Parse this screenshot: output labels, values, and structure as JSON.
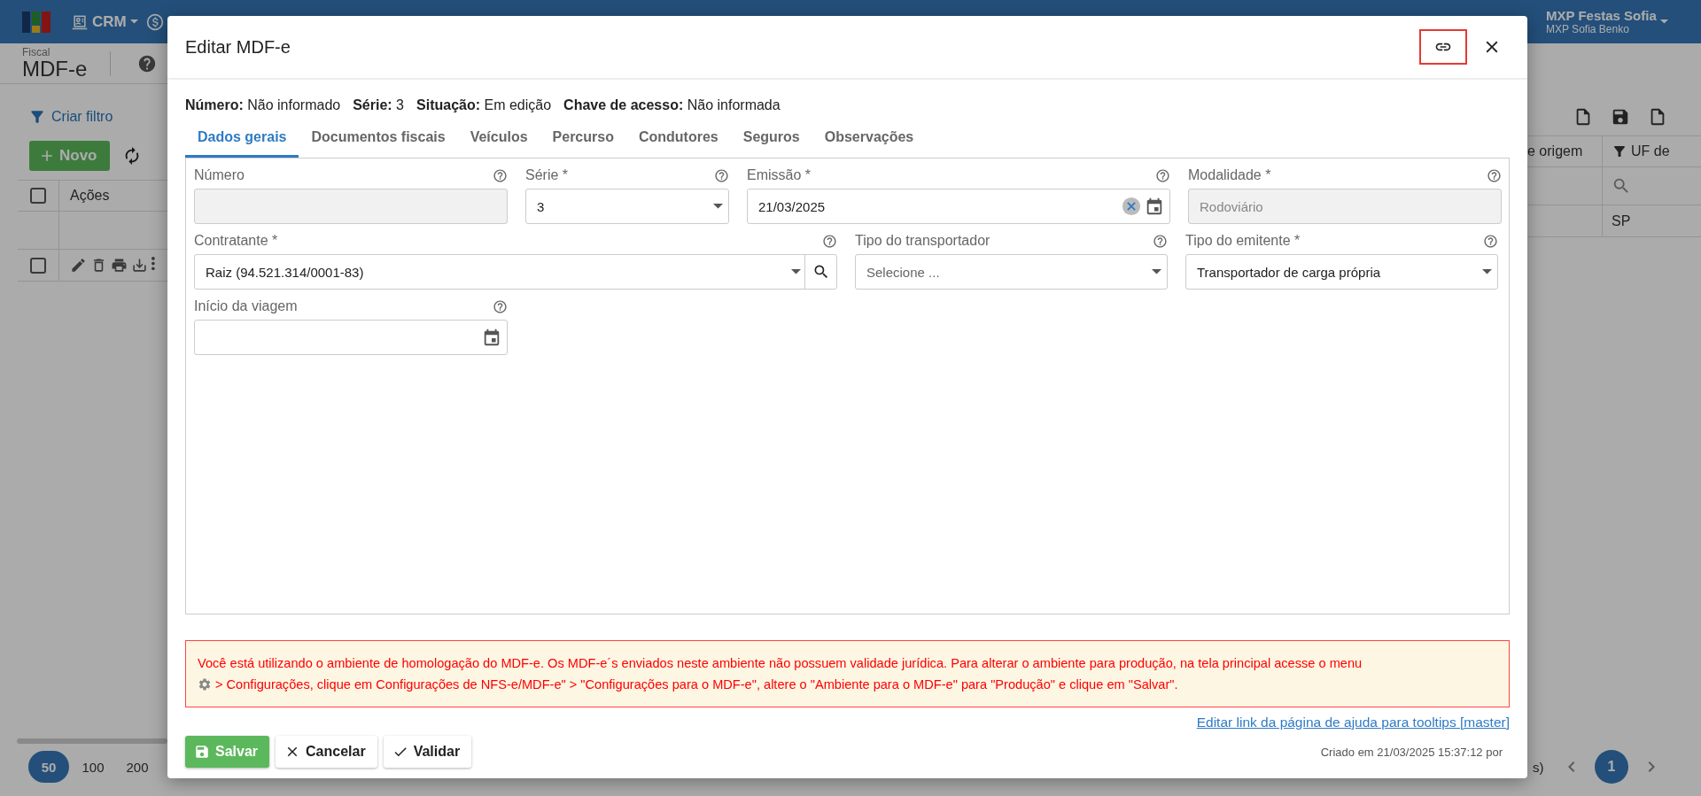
{
  "app_bar": {
    "menu": {
      "label": "CRM"
    },
    "user": {
      "company": "MXP Festas Sofia",
      "name": "MXP Sofia Benko"
    }
  },
  "page": {
    "breadcrumb": "Fiscal",
    "title": "MDF-e",
    "filter_link": "Criar filtro",
    "new_button": "Novo",
    "table": {
      "select_all_checked": false,
      "columns": [
        "Ações",
        "e origem",
        "UF de"
      ],
      "rows": [
        {
          "checked": false,
          "uf": "SP"
        }
      ]
    },
    "pagination": {
      "page_sizes": [
        {
          "label": "50",
          "selected": true
        },
        {
          "label": "100",
          "selected": false
        },
        {
          "label": "200",
          "selected": false
        }
      ],
      "summary": "s)",
      "pages": [
        {
          "label": "1",
          "selected": true
        }
      ]
    }
  },
  "modal": {
    "title": "Editar MDF-e",
    "info": [
      {
        "label": "Número:",
        "value": "Não informado"
      },
      {
        "label": "Série:",
        "value": "3"
      },
      {
        "label": "Situação:",
        "value": "Em edição"
      },
      {
        "label": "Chave de acesso:",
        "value": "Não informada"
      }
    ],
    "tabs": [
      {
        "label": "Dados gerais",
        "selected": true
      },
      {
        "label": "Documentos fiscais",
        "selected": false
      },
      {
        "label": "Veículos",
        "selected": false
      },
      {
        "label": "Percurso",
        "selected": false
      },
      {
        "label": "Condutores",
        "selected": false
      },
      {
        "label": "Seguros",
        "selected": false
      },
      {
        "label": "Observações",
        "selected": false
      }
    ],
    "field_rows": [
      [
        {
          "label": "Número",
          "kind": "text",
          "disabled": true
        },
        {
          "label": "Série *",
          "kind": "select",
          "value": "3"
        },
        {
          "label": "Emissão *",
          "kind": "date",
          "value": "21/03/2025",
          "clearable": true
        },
        {
          "label": "Modalidade *",
          "kind": "text",
          "disabled": true,
          "value": "Rodoviário"
        }
      ],
      [
        {
          "label": "Contratante *",
          "kind": "lookup",
          "value": "Raiz (94.521.314/0001-83)"
        },
        {
          "label": "Tipo do transportador",
          "kind": "select",
          "placeholder": "Selecione ..."
        },
        {
          "label": "Tipo do emitente *",
          "kind": "select",
          "value": "Transportador de carga própria"
        }
      ],
      [
        {
          "label": "Início da viagem",
          "kind": "date"
        }
      ]
    ],
    "alert": {
      "line_1": "Você está utilizando o ambiente de homologação do MDF-e. Os MDF-e´s enviados neste ambiente não possuem validade jurídica. Para alterar o ambiente para produção, na tela principal acesse o menu",
      "line_2": "> Configurações, clique em Configurações de NFS-e/MDF-e\" > \"Configurações para o MDF-e\", altere o \"Ambiente para o MDF-e\" para \"Produção\" e clique em \"Salvar\"."
    },
    "help_link": "Editar link da página de ajuda para tooltips [master]",
    "buttons": [
      {
        "label": "Salvar",
        "kind": "save"
      },
      {
        "label": "Cancelar",
        "kind": "cancel"
      },
      {
        "label": "Validar",
        "kind": "validate"
      }
    ],
    "created": "Criado em 21/03/2025 15:37:12 por"
  }
}
